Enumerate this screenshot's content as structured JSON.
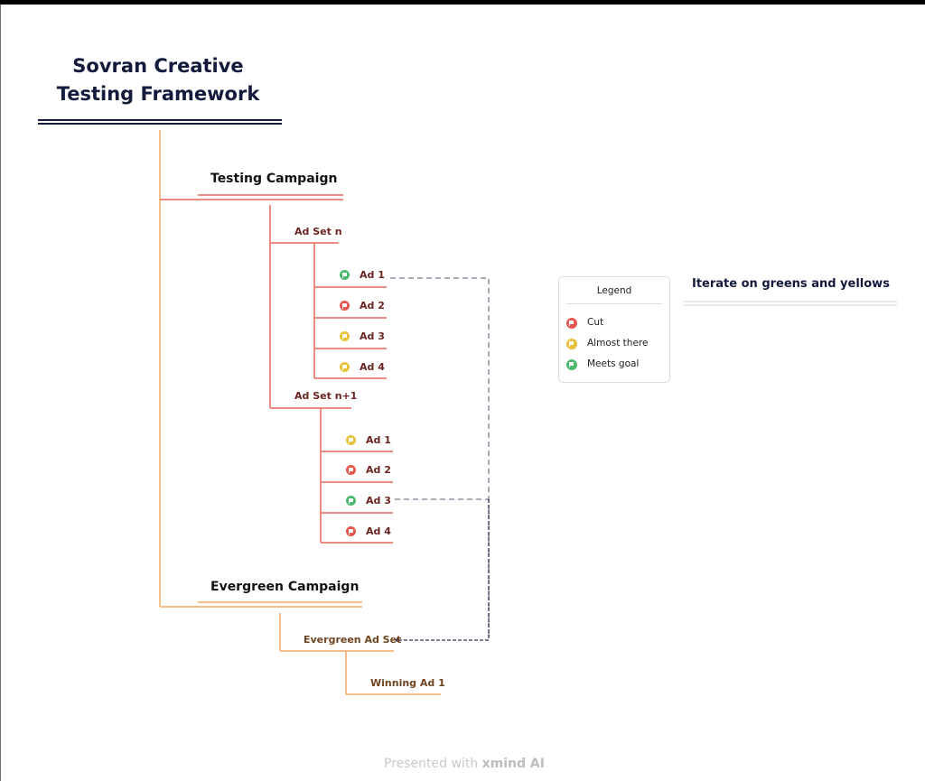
{
  "title": "Sovran Creative Testing Framework",
  "title_lines": [
    "Sovran Creative",
    "Testing Framework"
  ],
  "colors": {
    "title_navy": "#141a3c",
    "testing_branch": "#e8675a",
    "evergreen_branch": "#f2a865",
    "relation_dashed": "#7a7a90",
    "cut": "#e8574f",
    "almost_there": "#e8c13a",
    "meets_goal": "#4fb86f"
  },
  "campaigns": [
    {
      "label": "Testing Campaign",
      "ad_sets": [
        {
          "label": "Ad Set n",
          "ads": [
            {
              "label": "Ad 1",
              "status": "meets_goal"
            },
            {
              "label": "Ad 2",
              "status": "cut"
            },
            {
              "label": "Ad 3",
              "status": "almost_there"
            },
            {
              "label": "Ad 4",
              "status": "almost_there"
            }
          ]
        },
        {
          "label": "Ad Set n+1",
          "ads": [
            {
              "label": "Ad 1",
              "status": "almost_there"
            },
            {
              "label": "Ad 2",
              "status": "cut"
            },
            {
              "label": "Ad 3",
              "status": "meets_goal"
            },
            {
              "label": "Ad 4",
              "status": "cut"
            }
          ]
        }
      ]
    },
    {
      "label": "Evergreen Campaign",
      "ad_sets": [
        {
          "label": "Evergreen Ad Set",
          "ads": [
            {
              "label": "Winning Ad 1"
            }
          ]
        }
      ]
    }
  ],
  "relationships": [
    {
      "from": "Ad Set n / Ad 1",
      "to": "Evergreen Ad Set"
    },
    {
      "from": "Ad Set n+1 / Ad 3",
      "to": "Evergreen Ad Set"
    }
  ],
  "legend": {
    "title": "Legend",
    "items": [
      {
        "label": "Cut",
        "status": "cut"
      },
      {
        "label": "Almost there",
        "status": "almost_there"
      },
      {
        "label": "Meets goal",
        "status": "meets_goal"
      }
    ]
  },
  "floating_note": "Iterate on greens and yellows",
  "footer": {
    "prefix": "Presented with",
    "brand": "xmind AI"
  }
}
